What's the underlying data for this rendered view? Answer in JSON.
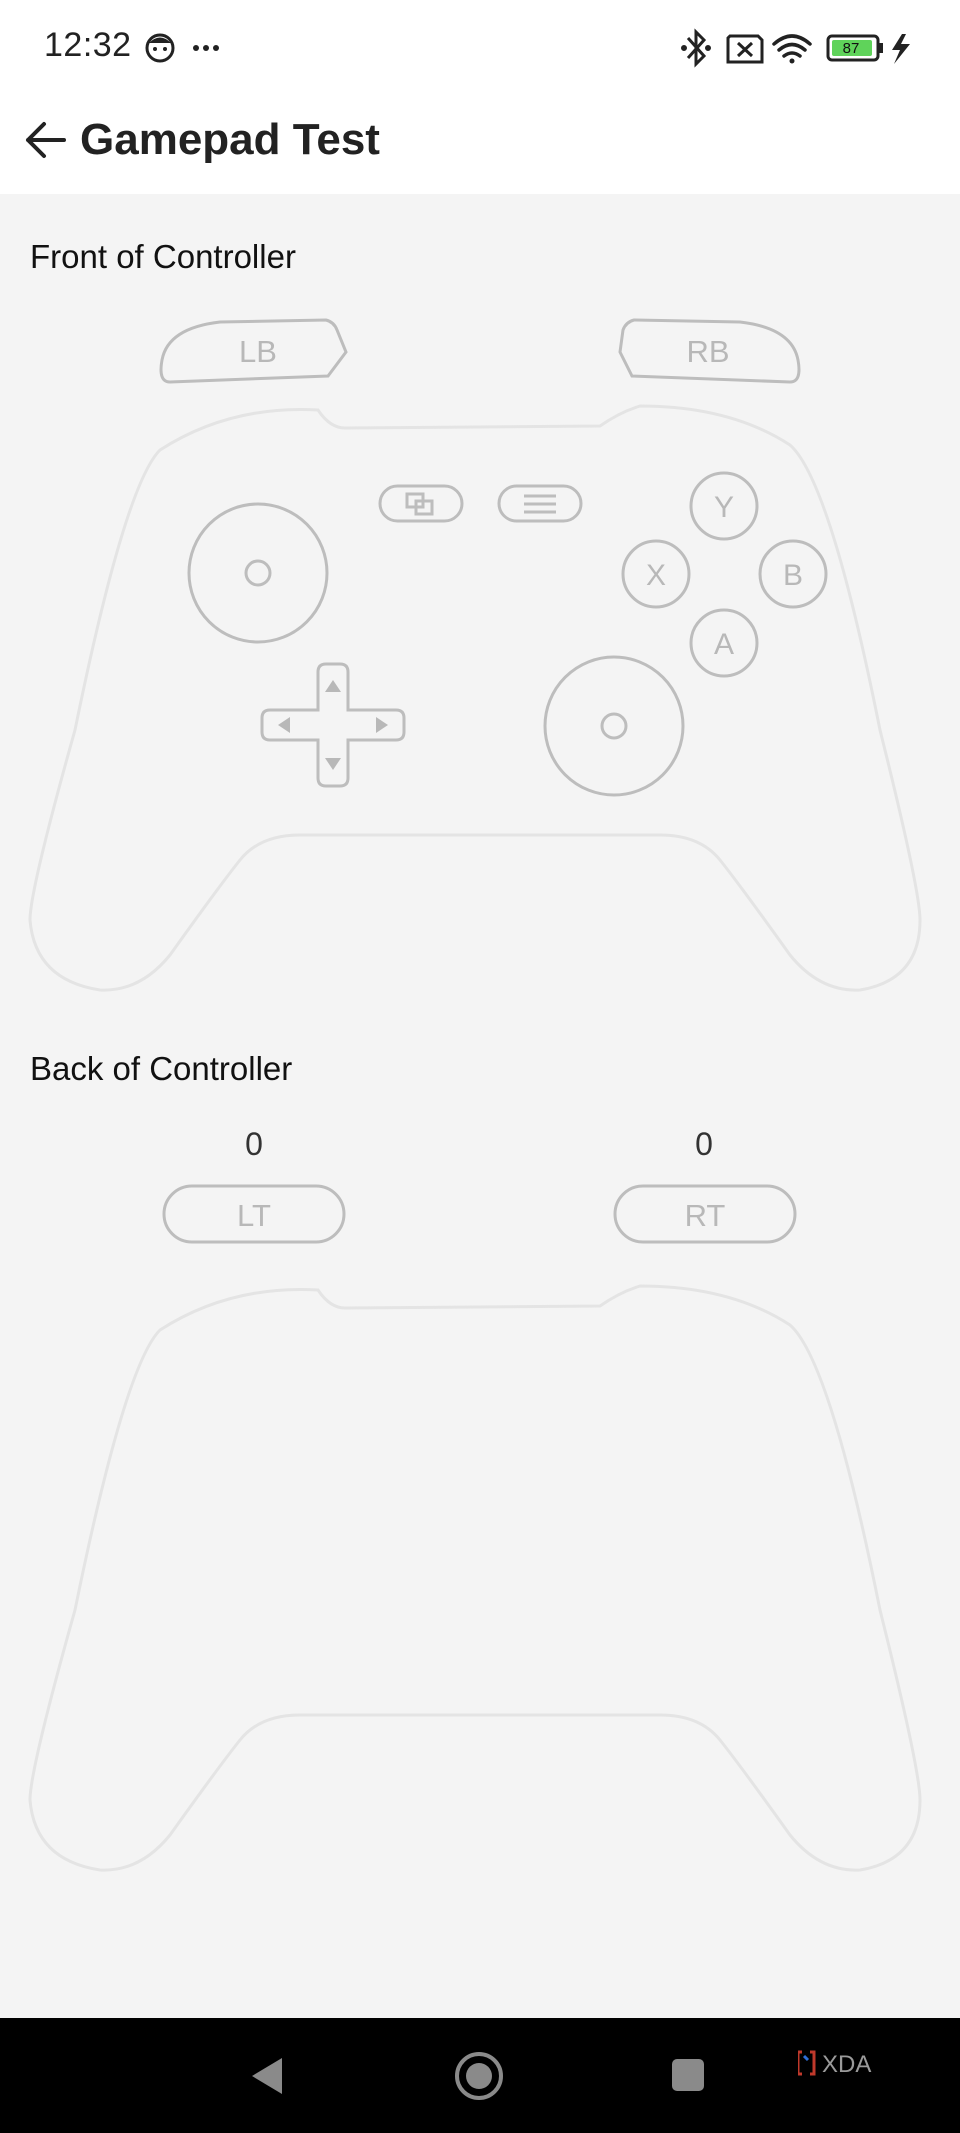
{
  "status_bar": {
    "time": "12:32",
    "left_icons": [
      "face-icon",
      "more-dots-icon"
    ],
    "right_icons": [
      "bluetooth-icon",
      "no-sim-icon",
      "wifi-icon",
      "battery-icon",
      "charging-icon"
    ],
    "battery_level": "87",
    "battery_color": "#5fd35a"
  },
  "app_bar": {
    "title": "Gamepad Test",
    "back_icon": "arrow-left-icon"
  },
  "front": {
    "title": "Front of Controller",
    "lb_label": "LB",
    "rb_label": "RB",
    "y_label": "Y",
    "x_label": "X",
    "b_label": "B",
    "a_label": "A",
    "view_icon": "view-icon",
    "menu_icon": "menu-icon"
  },
  "back": {
    "title": "Back of Controller",
    "lt_label": "LT",
    "rt_label": "RT",
    "lt_value": "0",
    "rt_value": "0"
  },
  "nav_bar": {
    "back_icon": "nav-back-icon",
    "home_icon": "nav-home-icon",
    "recents_icon": "nav-recents-icon"
  },
  "watermark": {
    "text": "XDA"
  },
  "colors": {
    "background": "#f4f4f4",
    "outline": "#bdbdbd",
    "body_outline": "#e4e4e4",
    "label": "#b8b8b8"
  }
}
